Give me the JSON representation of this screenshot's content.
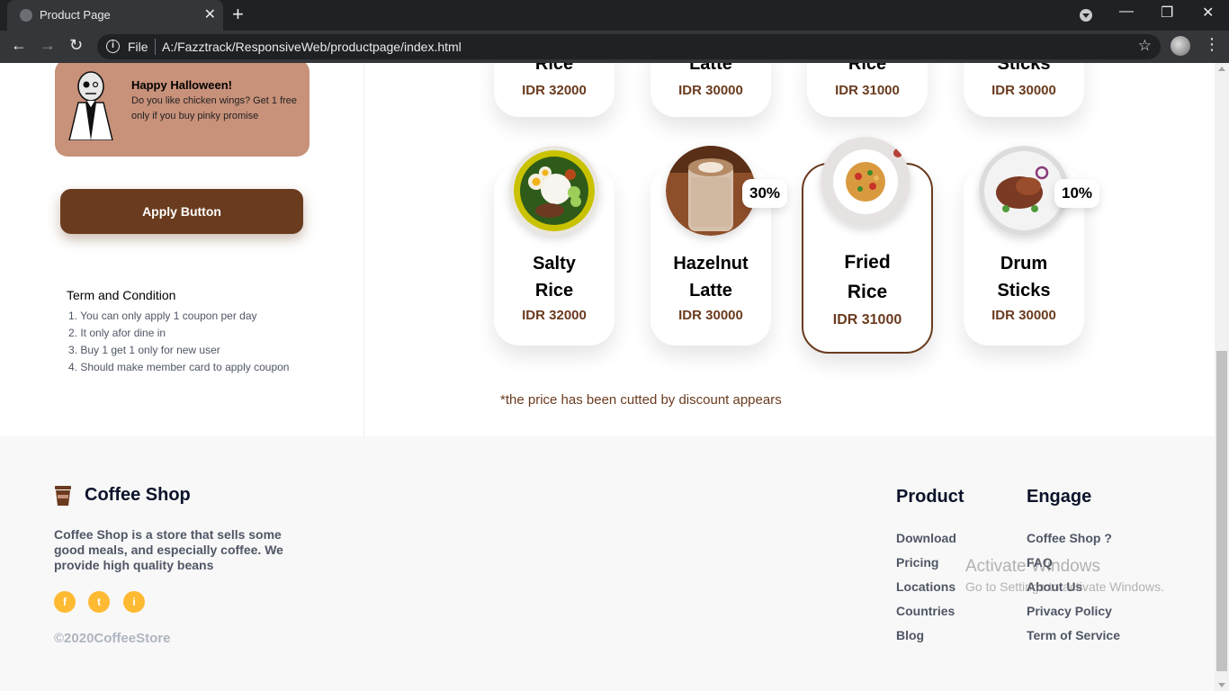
{
  "browser": {
    "tab_title": "Product Page",
    "tab_close": "✕",
    "new_tab": "+",
    "scheme": "File",
    "url": "A:/Fazztrack/ResponsiveWeb/productpage/index.html",
    "win_min": "—",
    "win_restore": "❐",
    "win_close": "✕"
  },
  "promo": {
    "title": "Happy Halloween!",
    "description": "Do you like chicken wings? Get 1 free only if you buy pinky promise"
  },
  "apply_button": "Apply Button",
  "terms": {
    "title": "Term and Condition",
    "items": [
      "1. You can only apply 1 coupon per day",
      "2. It only afor dine in",
      "3. Buy 1 get 1 only for new user",
      "4. Should make member card to apply coupon"
    ]
  },
  "top_row": [
    {
      "name": "Rice",
      "price": "IDR 32000"
    },
    {
      "name": "Latte",
      "price": "IDR 30000"
    },
    {
      "name": "Rice",
      "price": "IDR 31000"
    },
    {
      "name": "Sticks",
      "price": "IDR 30000"
    }
  ],
  "products": [
    {
      "name_line1": "Salty",
      "name_line2": "Rice",
      "price": "IDR 32000",
      "discount": ""
    },
    {
      "name_line1": "Hazelnut",
      "name_line2": "Latte",
      "price": "IDR 30000",
      "discount": "30%"
    },
    {
      "name_line1": "Fried",
      "name_line2": "Rice",
      "price": "IDR 31000",
      "discount": ""
    },
    {
      "name_line1": "Drum",
      "name_line2": "Sticks",
      "price": "IDR 30000",
      "discount": "10%"
    }
  ],
  "disclaimer": "*the price has been cutted by discount appears",
  "footer": {
    "brand": "Coffee Shop",
    "description": "Coffee Shop is a store that sells some good meals, and especially coffee. We provide high quality beans",
    "social": [
      "f",
      "t",
      "i"
    ],
    "copyright": "©2020CoffeeStore",
    "product_title": "Product",
    "product_links": [
      "Download",
      "Pricing",
      "Locations",
      "Countries",
      "Blog"
    ],
    "engage_title": "Engage",
    "engage_links": [
      "Coffee Shop ?",
      "FAQ",
      "About Us",
      "Privacy Policy",
      "Term of Service"
    ]
  },
  "watermark": {
    "line1": "Activate Windows",
    "line2": "Go to Settings to activate Windows."
  },
  "colors": {
    "brand_brown": "#6a3b1e",
    "promo_bg": "#c8917a",
    "social_yellow": "#ffba33"
  }
}
